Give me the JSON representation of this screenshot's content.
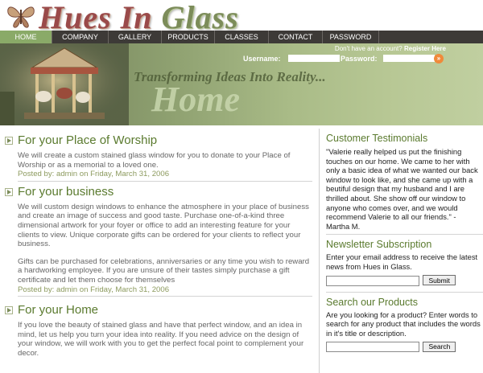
{
  "site": {
    "title_part1": "Hues In ",
    "title_part2": "Glass"
  },
  "nav": {
    "items": [
      {
        "label": "HOME",
        "active": true
      },
      {
        "label": "COMPANY",
        "active": false
      },
      {
        "label": "GALLERY",
        "active": false
      },
      {
        "label": "PRODUCTS",
        "active": false
      },
      {
        "label": "CLASSES",
        "active": false
      },
      {
        "label": "CONTACT",
        "active": false
      },
      {
        "label": "PASSWORD",
        "active": false
      }
    ]
  },
  "login": {
    "hint": "Don't have an account?",
    "register": "Register Here",
    "username_label": "Username:",
    "password_label": "Password:",
    "go_label": "»"
  },
  "banner": {
    "tagline": "Transforming Ideas Into Reality...",
    "page_word": "Home"
  },
  "posts": [
    {
      "title": "For your Place of Worship",
      "paragraphs": [
        "We will create a custom stained glass window for you to donate to your Place of Worship or as a memorial to a loved one."
      ],
      "meta": "Posted by: admin on Friday, March 31, 2006"
    },
    {
      "title": "For your business",
      "paragraphs": [
        "We will custom design windows to enhance the atmosphere in your place of business and create an image of success and good taste. Purchase one-of-a-kind three dimensional artwork for your foyer or office to add an interesting feature for your clients to view. Unique corporate gifts can be ordered for your clients to reflect your business.",
        "Gifts can be purchased for celebrations, anniversaries or any time you wish to reward a hardworking employee. If you are unsure of their tastes simply purchase a gift certificate and let them choose for themselves"
      ],
      "meta": "Posted by: admin on Friday, March 31, 2006"
    },
    {
      "title": "For your Home",
      "paragraphs": [
        "If you love the beauty of stained glass and have that perfect window, and an idea in mind, let us help you turn your idea into reality. If you need advice on the design of your window, we will work with you to get the perfect focal point to complement your decor."
      ],
      "meta": ""
    }
  ],
  "sidebar": {
    "testimonials": {
      "heading": "Customer Testimonials",
      "text": "\"Valerie really helped us put the finishing touches on our home. We came to her with only a basic idea of what we wanted our back window to look like, and she came up with a beutiful design that my husband and I are thrilled about. She show off our window to anyone who comes over, and we would recommend Valerie to all our friends.\" - Martha M."
    },
    "newsletter": {
      "heading": "Newsletter Subscription",
      "text": "Enter your email address to receive the latest news from Hues in Glass.",
      "button": "Submit"
    },
    "search": {
      "heading": "Search our Products",
      "text": "Are you looking for a product? Enter words to search for any product that includes the words in it's title or description.",
      "button": "Search"
    }
  }
}
